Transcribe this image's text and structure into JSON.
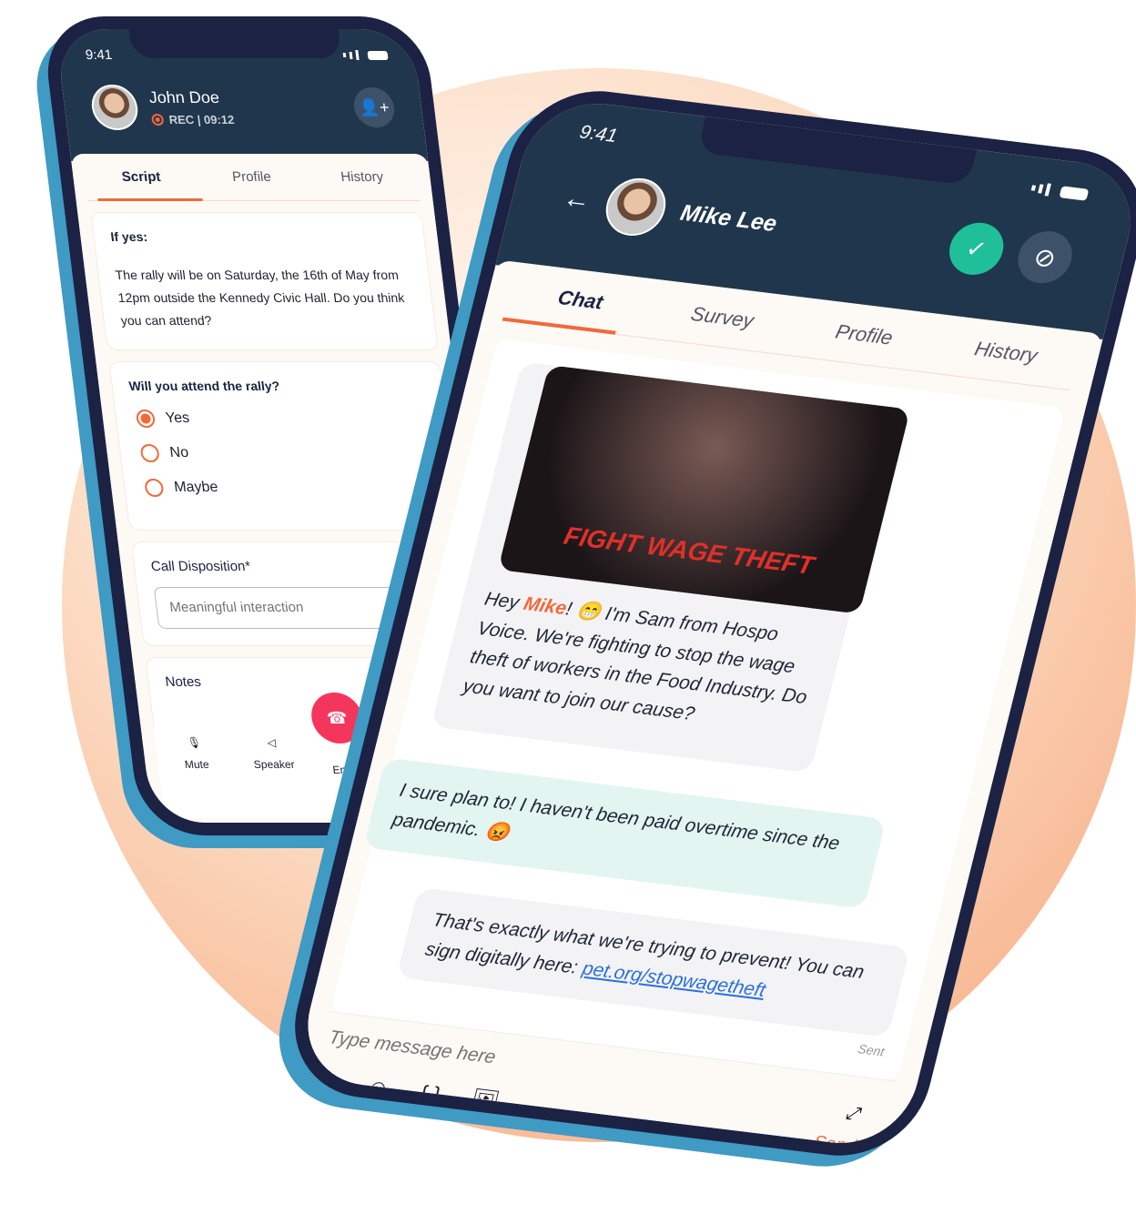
{
  "left_phone": {
    "time": "9:41",
    "contact_name": "John Doe",
    "rec_status": "REC | 09:12",
    "tabs": [
      "Script",
      "Profile",
      "History"
    ],
    "script_heading": "If yes:",
    "script_text": "The rally will be on Saturday, the 16th of May from 12pm outside the Kennedy Civic Hall. Do you think you can attend?",
    "question": "Will you attend the rally?",
    "options": [
      {
        "label": "Yes",
        "selected": true
      },
      {
        "label": "No",
        "selected": false
      },
      {
        "label": "Maybe",
        "selected": false
      }
    ],
    "disposition_label": "Call Disposition*",
    "disposition_placeholder": "Meaningful interaction",
    "notes_label": "Notes",
    "controls": [
      "Mute",
      "Speaker",
      "End call"
    ]
  },
  "right_phone": {
    "time": "9:41",
    "contact_name": "Mike Lee",
    "tabs": [
      "Chat",
      "Survey",
      "Profile",
      "History"
    ],
    "image_logo_text": "FIGHT WAGE THEFT",
    "msg1_prefix": "Hey ",
    "msg1_name": "Mike",
    "msg1_rest": "! 😁 I'm Sam from Hospo Voice. We're fighting to stop the wage theft of workers in the Food Industry. Do you want to join our cause?",
    "msg2": "I sure plan to! I haven't been paid overtime since the pandemic. 😡",
    "msg3_text": "That's exactly what we're trying to prevent! You can sign digitally here: ",
    "msg3_link": "pet.org/stopwagetheft",
    "sent_label": "Sent",
    "input_placeholder": "Type message here",
    "send_label": "Send"
  },
  "colors": {
    "accent": "#f06a3a",
    "header": "#20364c",
    "end_call": "#f5365c",
    "confirm": "#1fbf9a"
  }
}
